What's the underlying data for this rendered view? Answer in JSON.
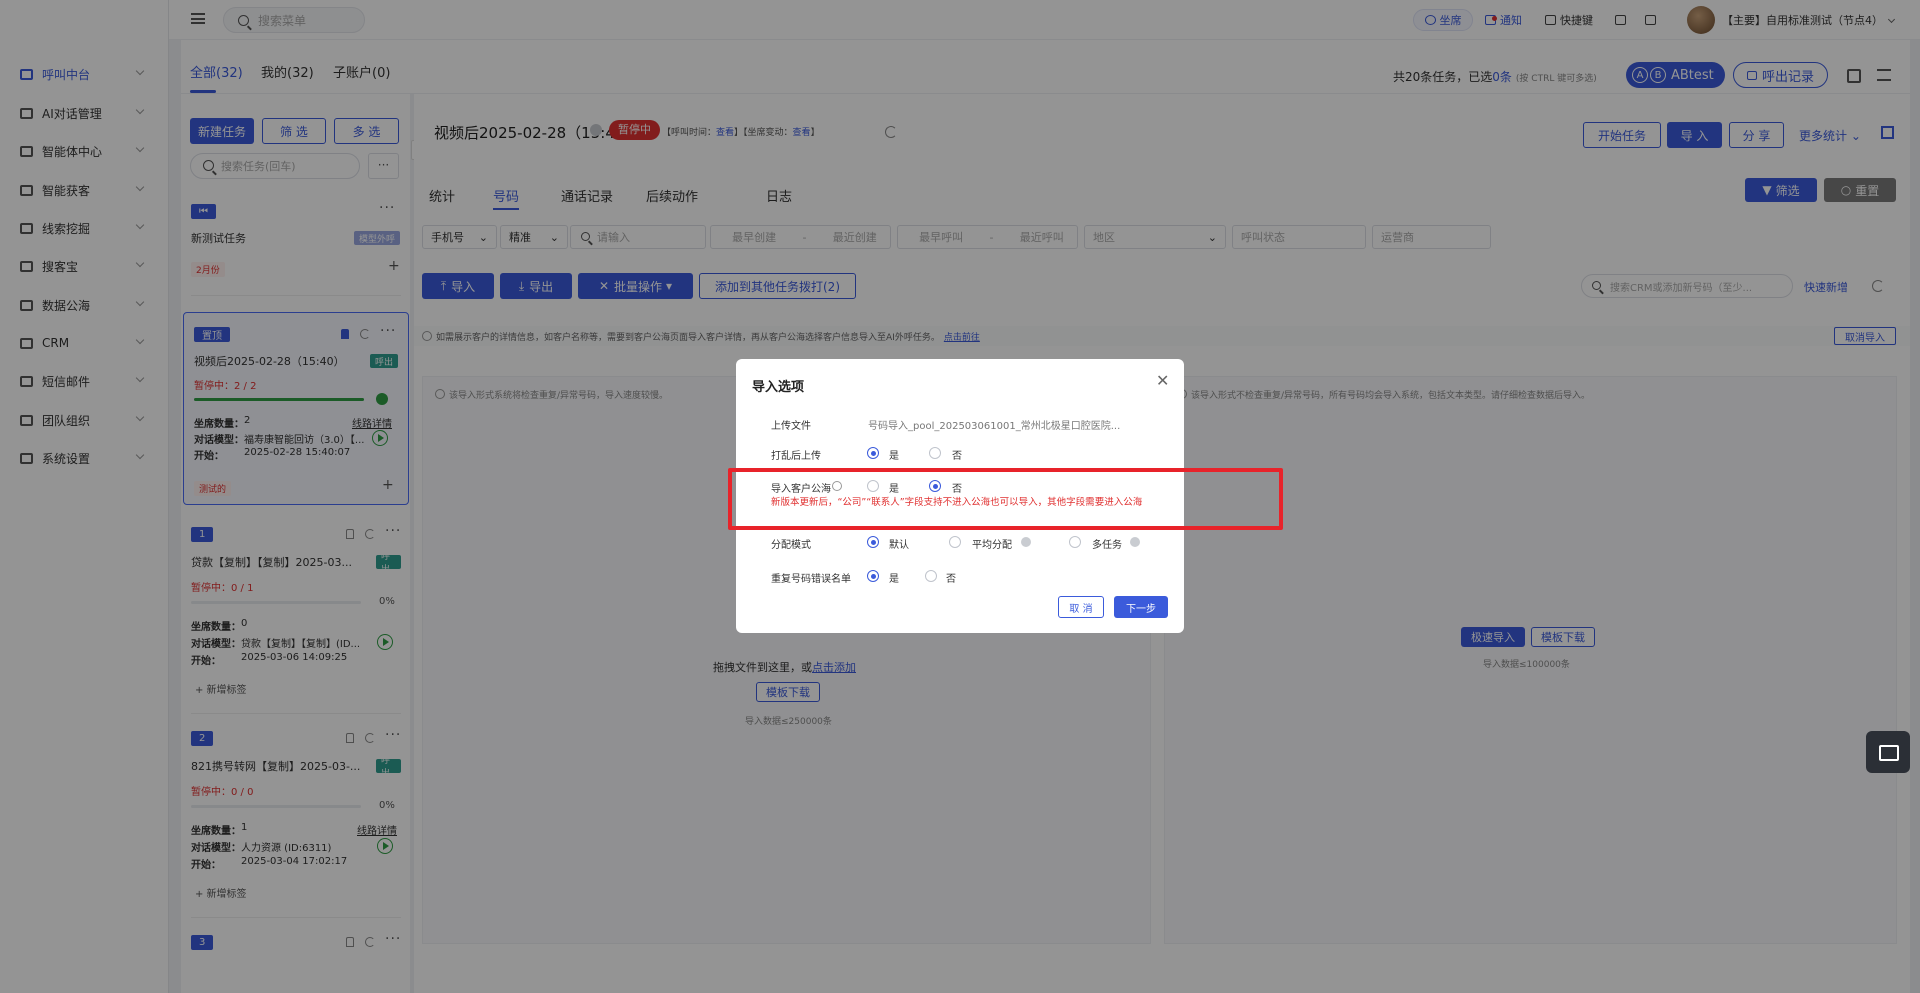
{
  "sidebar": {
    "items": [
      {
        "label": "呼叫中台",
        "active": true
      },
      {
        "label": "AI对话管理"
      },
      {
        "label": "智能体中心"
      },
      {
        "label": "智能获客"
      },
      {
        "label": "线索挖掘"
      },
      {
        "label": "搜客宝"
      },
      {
        "label": "数据公海"
      },
      {
        "label": "CRM"
      },
      {
        "label": "短信邮件"
      },
      {
        "label": "团队组织"
      },
      {
        "label": "系统设置"
      }
    ]
  },
  "topbar": {
    "search_placeholder": "搜索菜单",
    "seat": "坐席",
    "notify": "通知",
    "shortcut": "快捷键",
    "user": "【主要】自用标准测试（节点4）"
  },
  "tabs_top": {
    "all": "全部(32)",
    "mine": "我的(32)",
    "sub": "子账户(0)",
    "summary": "共20条任务，已选",
    "selected": "0条",
    "hint": "(按 CTRL 键可多选)",
    "abtest": "ABtest",
    "ab_a": "A",
    "ab_b": "B",
    "call_records": "呼出记录"
  },
  "left": {
    "new_task": "新建任务",
    "filter": "筛 选",
    "multi": "多 选",
    "search_placeholder": "搜索任务(回车)",
    "dots": "···",
    "card0": {
      "title": "新测试任务",
      "tag": "模型外呼",
      "date": "2月份"
    },
    "card1": {
      "badge": "置顶",
      "title": "视频后2025-02-28（15:40）",
      "tag": "呼出",
      "status": "暂停中：2 / 2",
      "progress": 100,
      "seats_label": "坐席数量：",
      "seats": "2",
      "link": "线路详情",
      "model_label": "对话模型：",
      "model": "福寿康智能回访（3.0）【...",
      "start_label": "开始：",
      "start": "2025-02-28 15:40:07",
      "date": "测试的"
    },
    "card2": {
      "badge": "1",
      "title": "贷款【复制】【复制】2025-03...",
      "tag": "呼出",
      "status": "暂停中：0 / 1",
      "pct": "0%",
      "progress": 0,
      "seats_label": "坐席数量：",
      "seats": "0",
      "model_label": "对话模型：",
      "model": "贷款【复制】【复制】(ID...",
      "start_label": "开始：",
      "start": "2025-03-06 14:09:25",
      "add": "+ 新增标签"
    },
    "card3": {
      "badge": "2",
      "title": "821携号转网【复制】2025-03-...",
      "tag": "呼出",
      "status": "暂停中：0 / 0",
      "pct": "0%",
      "progress": 0,
      "seats_label": "坐席数量：",
      "seats": "1",
      "link": "线路详情",
      "model_label": "对话模型：",
      "model": "人力资源 (ID:6311)",
      "start_label": "开始：",
      "start": "2025-03-04 17:02:17",
      "add": "+ 新增标签"
    },
    "card4": {
      "badge": "3"
    }
  },
  "right": {
    "title": "视频后2025-02-28（15:40）",
    "status": "暂停中",
    "meta1": "【呼叫时间：",
    "meta1_link": "查看",
    "meta2": "】【坐席变动：",
    "meta2_link": "查看",
    "meta_end": "】",
    "start_task": "开始任务",
    "import": "导 入",
    "share": "分 享",
    "more_stats": "更多统计",
    "tabs": [
      "统计",
      "号码",
      "通话记录",
      "后续动作",
      "日志"
    ],
    "filter_btn": "筛选",
    "reset_btn": "重置",
    "f_phone": "手机号",
    "f_exact": "精准",
    "f_input": "请输入",
    "f_create_start": "最早创建",
    "f_create_end": "最近创建",
    "f_call_start": "最早呼叫",
    "f_call_end": "最近呼叫",
    "f_region": "地区",
    "f_call_status": "呼叫状态",
    "f_carrier": "运营商",
    "btn_import": "导入",
    "btn_export": "导出",
    "btn_batch": "批量操作",
    "btn_add_other": "添加到其他任务拨打(2)",
    "crm_search": "搜索CRM或添加新号码（至少...",
    "quick_add": "快速新增",
    "info_text": "如需展示客户的详情信息，如客户名称等，需要到客户公海页面导入客户详情，再从客户公海选择客户信息导入至AI外呼任务。",
    "info_link": "点击前往",
    "cancel_import": "取消导入",
    "left_drop_tip": "该导入形式系统将检查重复/异常号码，导入速度较慢。",
    "right_drop_tip": "该导入形式不检查重复/异常号码，所有号码均会导入系统，包括文本类型。请仔细检查数据后导入。",
    "drop_text": "拖拽文件到这里，或",
    "drop_link": "点击添加",
    "template_download": "模板下载",
    "limit_left": "导入数据≤250000条",
    "fast_import": "极速导入",
    "template_download2": "模板下载",
    "limit_right": "导入数据≤100000条"
  },
  "modal": {
    "title": "导入选项",
    "close": "✕",
    "upload_label": "上传文件",
    "upload_value": "号码导入_pool_202503061001_常州北极星口腔医院...",
    "shuffle_label": "打乱后上传",
    "yes": "是",
    "no": "否",
    "pool_label": "导入客户公海",
    "warn": "新版本更新后，“公司”“联系人”字段支持不进入公海也可以导入，其他字段需要进入公海",
    "mode_label": "分配模式",
    "mode_default": "默认",
    "mode_avg": "平均分配",
    "mode_multi": "多任务",
    "dup_label": "重复号码错误名单",
    "cancel": "取 消",
    "next": "下一步"
  },
  "colors": {
    "accent": "#3b5bdb",
    "danger": "#e03131",
    "highlight": "#e8232a",
    "success": "#2f9e44"
  }
}
